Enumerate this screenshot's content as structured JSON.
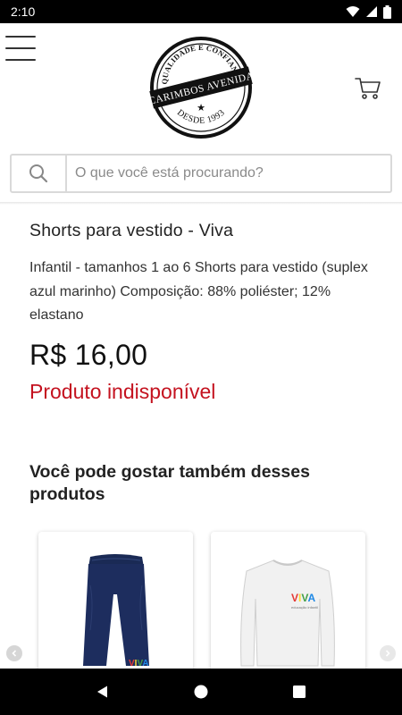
{
  "status_bar": {
    "time": "2:10"
  },
  "header": {
    "logo": {
      "top_text": "QUALIDADE E CONFIANÇA",
      "banner_text": "CARIMBOS AVENIDA",
      "bottom_text": "DESDE 1993"
    }
  },
  "search": {
    "placeholder": "O que você está procurando?"
  },
  "product": {
    "title": "Shorts para vestido - Viva",
    "description": "Infantil - tamanhos 1 ao 6 Shorts para vestido (suplex azul marinho) Composição: 88% poliéster; 12% elastano",
    "price": "R$ 16,00",
    "availability": "Produto indisponível"
  },
  "suggestions": {
    "title": "Você pode gostar também desses produtos",
    "items": [
      {
        "image_icon": "navy-pants-image",
        "brand": "VIVA"
      },
      {
        "image_icon": "white-long-sleeve-shirt-image",
        "brand": "VIVA",
        "brand_subtitle": "educação infantil"
      }
    ]
  },
  "colors": {
    "unavailable": "#c4121f",
    "status_bar": "#000000",
    "border": "#d9d9d9"
  }
}
